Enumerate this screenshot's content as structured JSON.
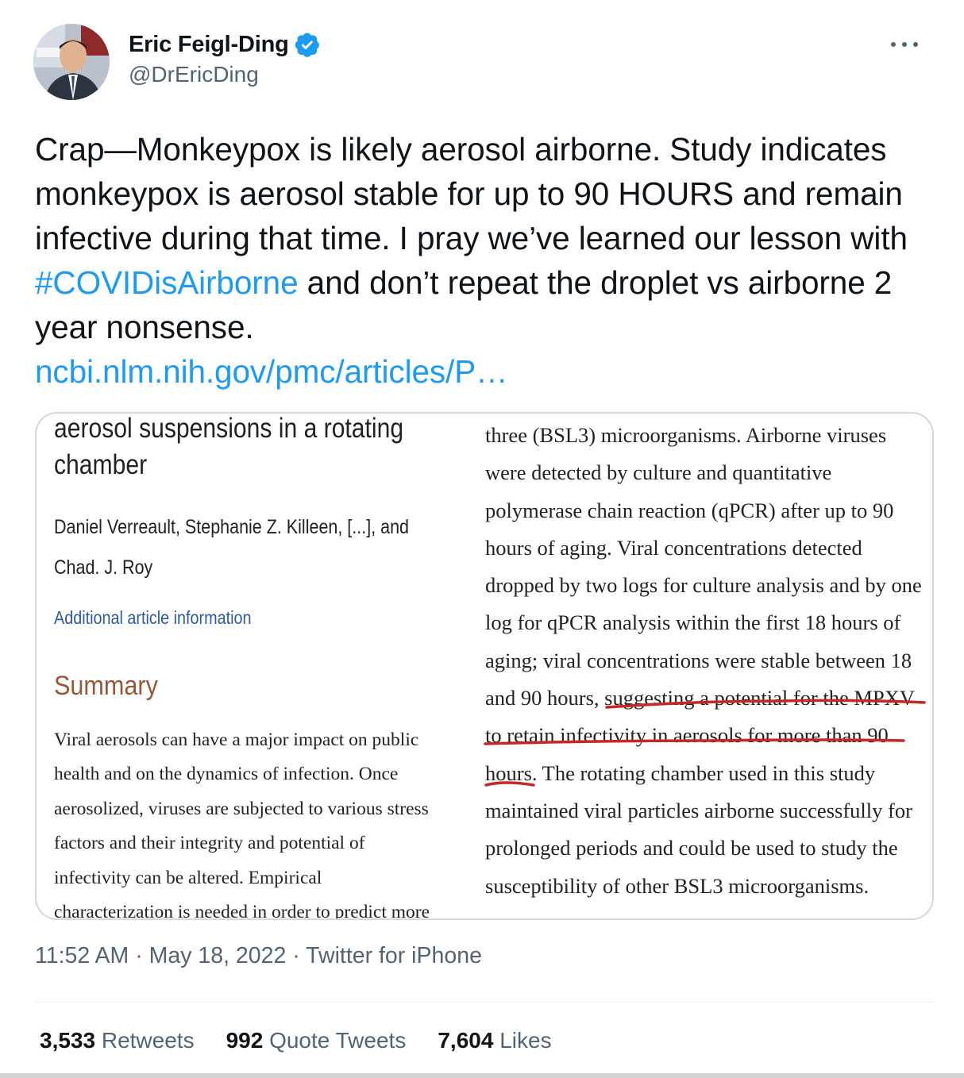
{
  "author": {
    "display_name": "Eric Feigl-Ding",
    "handle": "@DrEricDing",
    "verified_icon": "verified-badge-icon",
    "avatar_icon": "avatar"
  },
  "more_icon": "more-options-icon",
  "tweet": {
    "text_part1": "Crap—Monkeypox is likely aerosol airborne. Study indicates monkeypox is aerosol stable for up to 90 HOURS and remain infective during that time. I pray we’ve learned our lesson with ",
    "hashtag": "#COVIDisAirborne",
    "text_part2": " and don’t repeat the droplet vs airborne 2 year nonsense.",
    "link": "ncbi.nlm.nih.gov/pmc/articles/P…"
  },
  "media": {
    "title_line1": "aerosol suspensions in a rotating",
    "title_line2": "chamber",
    "authors_line1": "Daniel Verreault, Stephanie Z. Killeen, [...], and",
    "authors_line2": "Chad. J. Roy",
    "additional_info": "Additional article information",
    "summary_heading": "Summary",
    "summary_lines": [
      "Viral aerosols can have a major impact on public",
      "health and on the dynamics of infection. Once",
      "aerosolized, viruses are subjected to various stress",
      "factors and their integrity and potential of",
      "infectivity can be altered. Empirical",
      "characterization is needed in order to predict more"
    ],
    "right_lines": [
      "three (BSL3) microorganisms. Airborne viruses",
      "were detected by culture and quantitative",
      "polymerase chain reaction (qPCR) after up to 90",
      "hours of aging. Viral concentrations detected",
      "dropped by two logs for culture analysis and by one",
      "log for qPCR analysis within the first 18 hours of",
      "aging; viral concentrations were stable between 18",
      "and 90 hours, suggesting a potential for the MPXV",
      "to retain infectivity in aerosols for more than 90",
      "hours. The rotating chamber used in this study",
      "maintained viral particles airborne successfully for",
      "prolonged periods and could be used to study the",
      "susceptibility of other BSL3 microorganisms."
    ],
    "annotation_color": "#c62828"
  },
  "meta": {
    "time": "11:52 AM",
    "date": "May 18, 2022",
    "source": "Twitter for iPhone",
    "separator": " · "
  },
  "stats": {
    "retweets_count": "3,533",
    "retweets_label": "Retweets",
    "quotes_count": "992",
    "quotes_label": "Quote Tweets",
    "likes_count": "7,604",
    "likes_label": "Likes"
  },
  "colors": {
    "link": "#1d9bf0",
    "secondary_text": "#536471",
    "primary_text": "#0f1419",
    "verified": "#1d9bf0",
    "summary_heading": "#985735",
    "article_link": "#2f5aa0"
  }
}
